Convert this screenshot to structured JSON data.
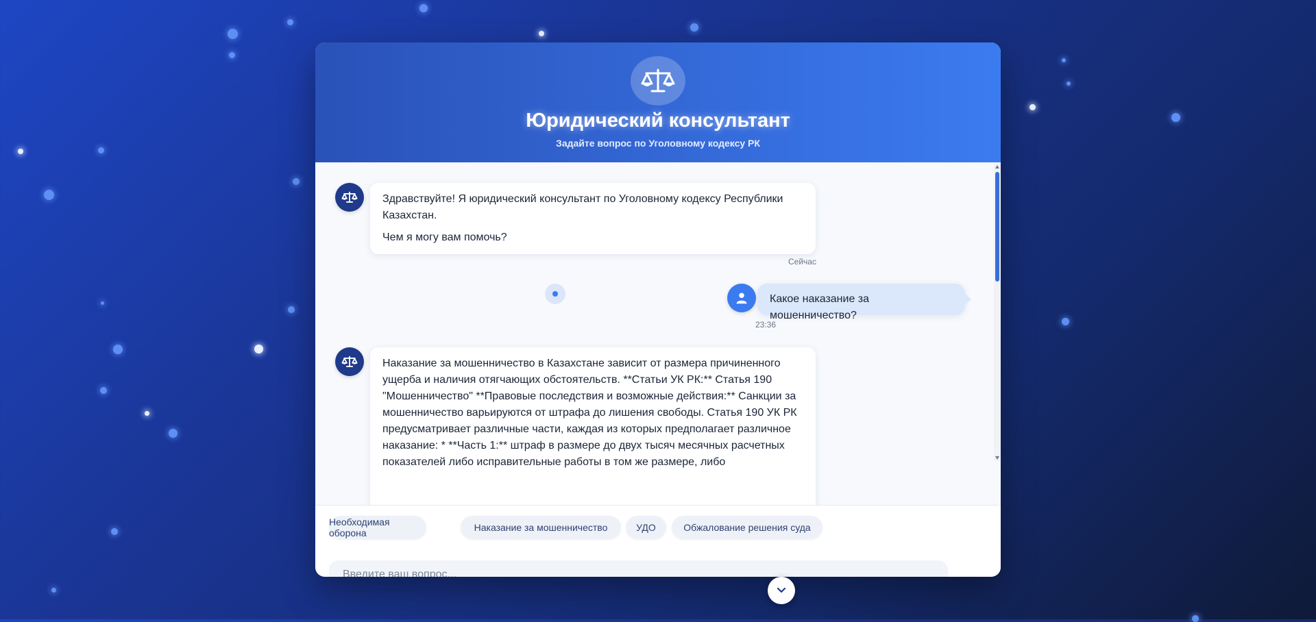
{
  "header": {
    "logo_icon": "scales-icon",
    "title": "Юридический консультант",
    "subtitle": "Задайте вопрос по Уголовному кодексу РК"
  },
  "messages": [
    {
      "role": "bot",
      "paragraphs": [
        "Здравствуйте! Я юридический консультант по Уголовному кодексу Республики Казахстан.",
        "Чем я могу вам помочь?"
      ],
      "time": "Сейчас"
    },
    {
      "role": "user",
      "text": "Какое наказание за мошенничество?",
      "time": "23:36"
    },
    {
      "role": "bot",
      "text": "Наказание за мошенничество в Казахстане зависит от размера причиненного ущерба и наличия отягчающих обстоятельств. **Статьи УК РК:** Статья 190 \"Мошенничество\" **Правовые последствия и возможные действия:** Санкции за мошенничество варьируются от штрафа до лишения свободы. Статья 190 УК РК предусматривает различные части, каждая из которых предполагает различное наказание: * **Часть 1:** штраф в размере до двух тысяч месячных расчетных показателей либо исправительные работы в том же размере, либо"
    }
  ],
  "suggestions": [
    "Необходимая оборона",
    "Наказание за мошенничество",
    "УДО",
    "Обжалование решения суда"
  ],
  "input": {
    "placeholder": "Введите ваш вопрос...",
    "value": ""
  },
  "icons": {
    "bot_avatar": "scales-icon",
    "user_avatar": "user-icon",
    "send": "paper-plane-icon",
    "scroll_down": "chevron-down-icon"
  },
  "colors": {
    "accent": "#3b7bf0",
    "header_dark": "#2a52b8",
    "bot_avatar": "#1f3a8a",
    "user_bubble": "#dbe7fb"
  }
}
